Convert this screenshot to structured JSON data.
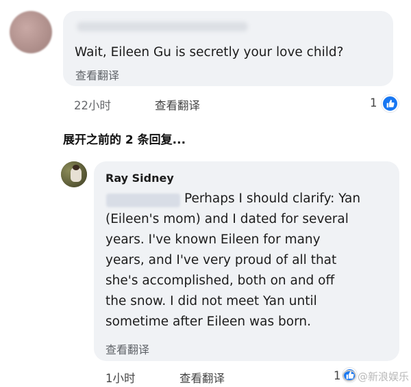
{
  "top_comment": {
    "text": "Wait, Eileen Gu is secretly your love child?",
    "translate_label": "查看翻译",
    "time": "22小时",
    "meta_translate": "查看翻译",
    "reaction_count": "1"
  },
  "expand_replies": {
    "label": "展开之前的 2 条回复..."
  },
  "reply": {
    "author": "Ray Sidney",
    "first_line": "Perhaps I should clarify: Yan",
    "lines": [
      "(Eileen's mom) and I dated for several",
      "years. I've known Eileen for many",
      "years, and I've very proud of all that",
      "she's accomplished, both on and off",
      "the snow. I did not meet Yan until",
      "sometime after Eileen was born."
    ],
    "translate_label": "查看翻译",
    "time": "1小时",
    "meta_translate": "查看翻译",
    "reaction_count": "1"
  },
  "watermark": {
    "text": "@新浪娱乐"
  },
  "icons": {
    "like": "thumbs-up-icon",
    "like_color": "#1877f2"
  }
}
